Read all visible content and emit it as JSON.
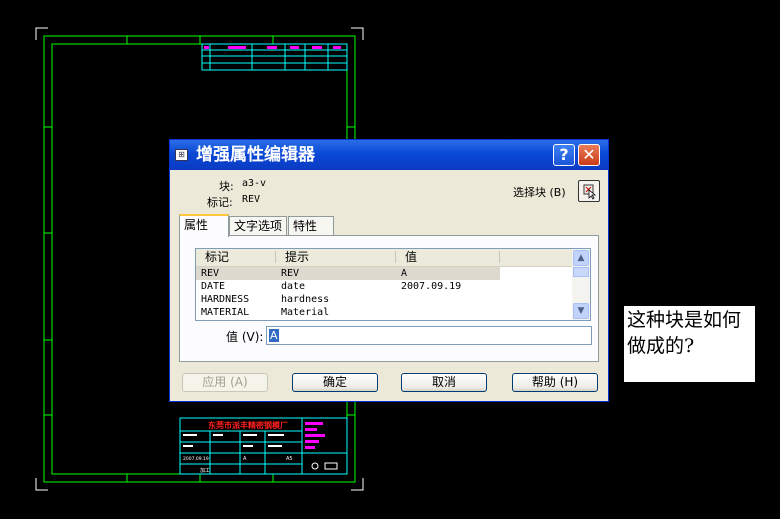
{
  "dialog": {
    "title": "增强属性编辑器",
    "help_glyph": "?",
    "close_glyph": "✕",
    "block_label": "块:",
    "block_value": "a3-v",
    "tag_label": "标记:",
    "tag_value": "REV",
    "select_block_label": "选择块 (B)",
    "tabs": [
      "属性",
      "文字选项",
      "特性"
    ],
    "columns": [
      "标记",
      "提示",
      "值"
    ],
    "rows": [
      {
        "tag": "REV",
        "prompt": "REV",
        "value": "A"
      },
      {
        "tag": "DATE",
        "prompt": "date",
        "value": "2007.09.19"
      },
      {
        "tag": "HARDNESS",
        "prompt": "hardness",
        "value": ""
      },
      {
        "tag": "MATERIAL",
        "prompt": "Material",
        "value": ""
      }
    ],
    "value_label": "值 (V):",
    "value_text": "A",
    "buttons": {
      "apply": "应用 (A)",
      "ok": "确定",
      "cancel": "取消",
      "help": "帮助 (H)"
    }
  },
  "drawing": {
    "title_block_company": "东莞市派丰精密钢模厂",
    "tb_values": [
      "2007.09.19",
      "A",
      "A5",
      "加工"
    ]
  },
  "note": "这种块是如何做成的?",
  "colors": {
    "frame": "#00ff00",
    "corner": "#ffffff",
    "accent": "#ff00ff",
    "title_red": "#ff2020",
    "tb_line": "#00ffff",
    "dialog_title": "#0a48d6"
  }
}
